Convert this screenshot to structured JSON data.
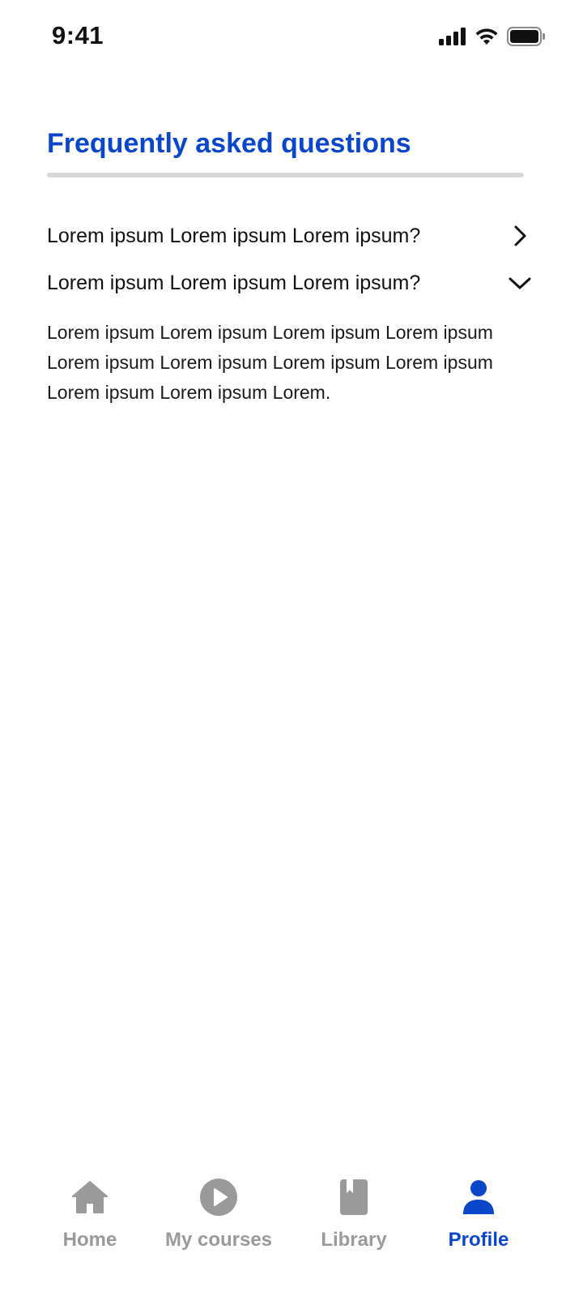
{
  "status_bar": {
    "time": "9:41"
  },
  "page": {
    "title": "Frequently asked questions"
  },
  "faq": [
    {
      "question": "Lorem ipsum Lorem ipsum Lorem ipsum?",
      "expanded": false,
      "icon": "chevron-right-icon"
    },
    {
      "question": "Lorem ipsum Lorem ipsum Lorem ipsum?",
      "expanded": true,
      "icon": "chevron-down-icon",
      "answer": "Lorem ipsum Lorem ipsum Lorem ipsum Lorem ipsum Lorem ipsum Lorem ipsum Lorem ipsum Lorem ipsum Lorem ipsum Lorem ipsum Lorem."
    }
  ],
  "bottom_nav": {
    "items": [
      {
        "label": "Home",
        "icon": "home-icon",
        "active": false
      },
      {
        "label": "My courses",
        "icon": "play-circle-icon",
        "active": false
      },
      {
        "label": "Library",
        "icon": "bookmark-book-icon",
        "active": false
      },
      {
        "label": "Profile",
        "icon": "user-icon",
        "active": true
      }
    ]
  },
  "colors": {
    "accent": "#0a46c8",
    "inactive_nav": "#9a9a9a",
    "divider": "#d9d9d9",
    "text": "#111111"
  }
}
